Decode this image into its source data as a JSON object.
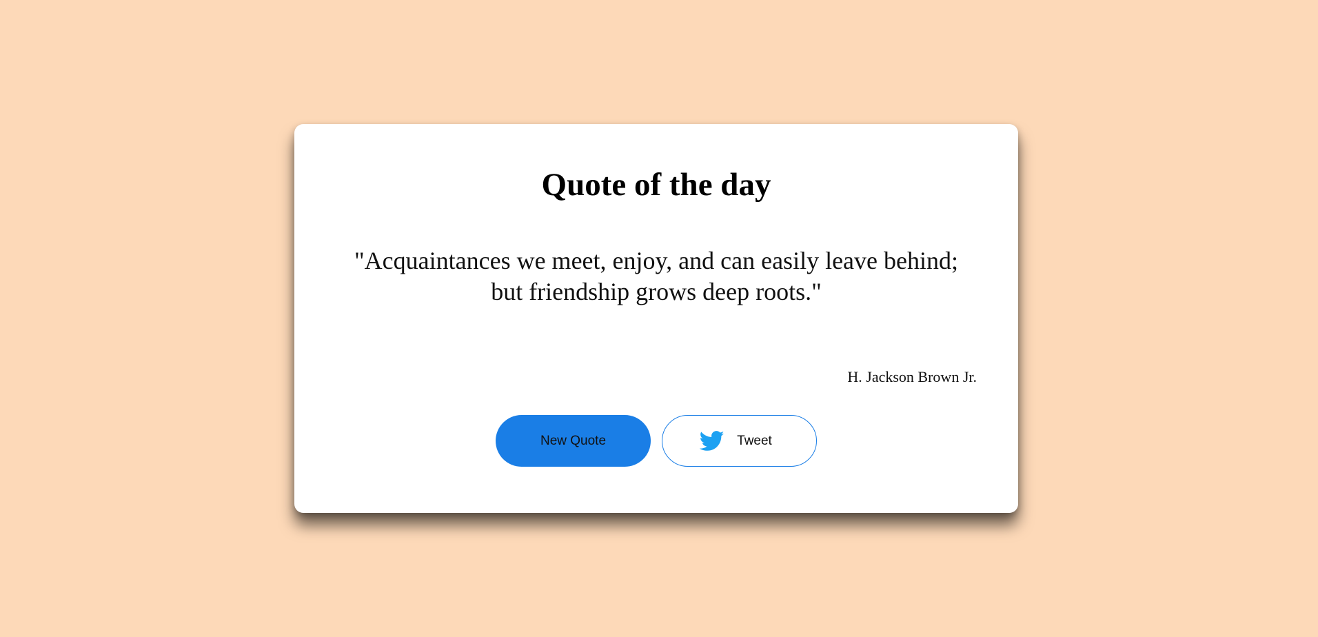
{
  "card": {
    "title": "Quote of the day",
    "quote": "\"Acquaintances we meet, enjoy, and can easily leave behind; but friendship grows deep roots.\"",
    "author": "H. Jackson Brown Jr."
  },
  "buttons": {
    "new_quote_label": "New Quote",
    "tweet_label": "Tweet",
    "tweet_icon": "twitter-bird-icon"
  },
  "colors": {
    "background": "#fdd9b8",
    "accent": "#1a7ee6",
    "twitter": "#1da1f2"
  }
}
